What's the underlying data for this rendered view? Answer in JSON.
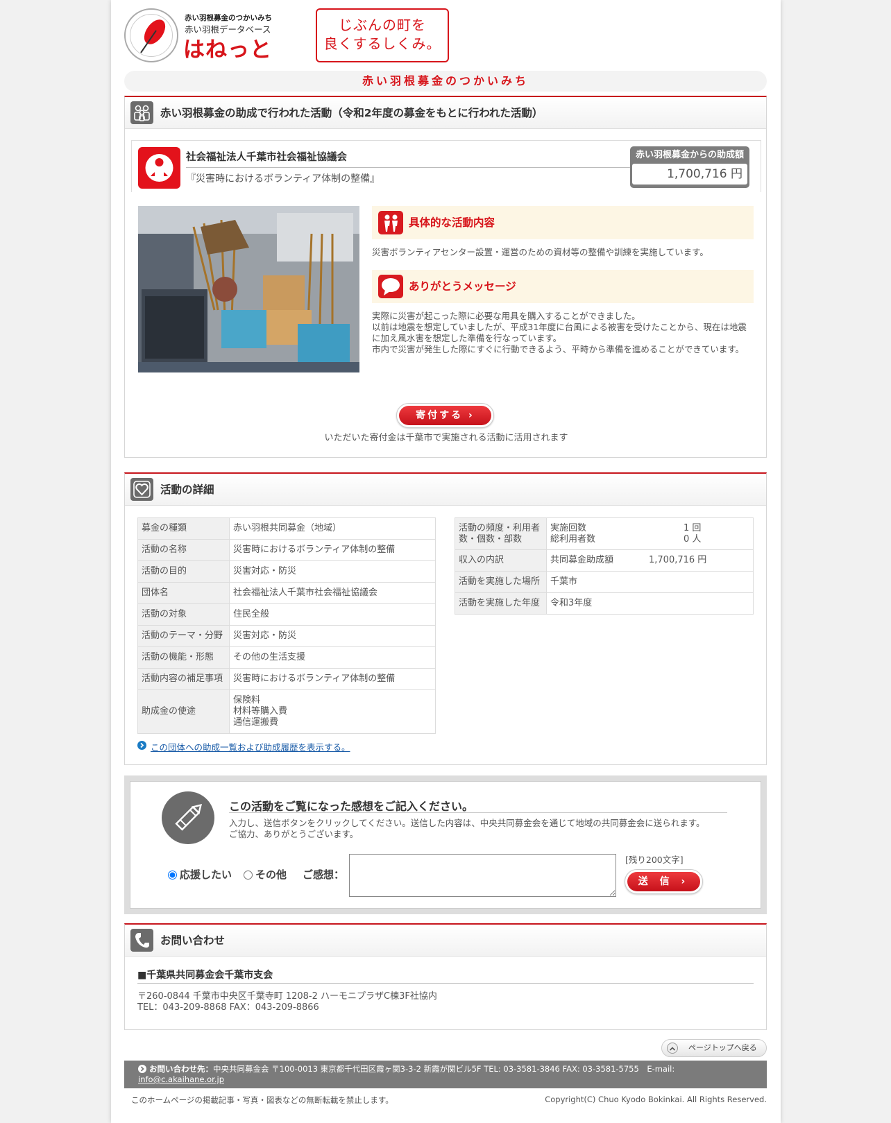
{
  "header": {
    "logo_line1": "赤い羽根募金のつかいみち",
    "logo_line2": "赤い羽根データベース",
    "logo_main": "はねっと",
    "slogan_line1": "じぶんの町を",
    "slogan_line2": "良くするしくみ。",
    "page_title": "赤い羽根募金のつかいみち"
  },
  "colors": {
    "brand_red": "#d7151b",
    "gray_icon": "#6b6b6b",
    "link_blue": "#1a5ca8"
  },
  "activity_section": {
    "title": "赤い羽根募金の助成で行われた活動（令和2年度の募金をもとに行われた活動）",
    "icon": "people-icon",
    "org_name": "社会福祉法人千葉市社会福祉協議会",
    "activity_name": "『災害時におけるボランティア体制の整備』",
    "grant_label": "赤い羽根募金からの助成額",
    "grant_value": "1,700,716 円",
    "content_title": "具体的な活動内容",
    "content_text": "災害ボランティアセンター設置・運営のための資材等の整備や訓練を実施しています。",
    "thanks_title": "ありがとうメッセージ",
    "thanks_lines": [
      "実際に災害が起こった際に必要な用具を購入することができました。",
      "以前は地震を想定していましたが、平成31年度に台風による被害を受けたことから、現在は地震に加え風水害を想定した準備を行なっています。",
      "市内で災害が発生した際にすぐに行動できるよう、平時から準備を進めることができています。"
    ],
    "donate_label": "寄付する ›",
    "donate_note": "いただいた寄付金は千葉市で実施される活動に活用されます"
  },
  "details_section": {
    "title": "活動の詳細",
    "left_rows": [
      {
        "k": "募金の種類",
        "v": "赤い羽根共同募金（地域）"
      },
      {
        "k": "活動の名称",
        "v": "災害時におけるボランティア体制の整備"
      },
      {
        "k": "活動の目的",
        "v": "災害対応・防災"
      },
      {
        "k": "団体名",
        "v": "社会福祉法人千葉市社会福祉協議会"
      },
      {
        "k": "活動の対象",
        "v": "住民全般"
      },
      {
        "k": "活動のテーマ・分野",
        "v": "災害対応・防災"
      },
      {
        "k": "活動の機能・形態",
        "v": "その他の生活支援"
      },
      {
        "k": "活動内容の補足事項",
        "v": "災害時におけるボランティア体制の整備"
      },
      {
        "k": "助成金の使途",
        "v": "保険料\n材料等購入費\n通信運搬費"
      }
    ],
    "right": {
      "freq_key": "活動の頻度・利用者数・個数・部数",
      "freq_items": [
        {
          "label": "実施回数",
          "value": "1 回"
        },
        {
          "label": "総利用者数",
          "value": "0 人"
        }
      ],
      "income_key": "収入の内訳",
      "income_label": "共同募金助成額",
      "income_value": "1,700,716 円",
      "place_key": "活動を実施した場所",
      "place_value": "千葉市",
      "year_key": "活動を実施した年度",
      "year_value": "令和3年度"
    },
    "history_link": "この団体への助成一覧および助成履歴を表示する。"
  },
  "feedback": {
    "title": "この活動をご覧になった感想をご記入ください。",
    "desc_line1": "入力し、送信ボタンをクリックしてください。送信した内容は、中央共同募金会を通じて地域の共同募金会に送られます。",
    "desc_line2": "ご協力、ありがとうございます。",
    "radio_support": "応援したい",
    "radio_other": "その他",
    "impression_label": "ご感想：",
    "remaining": "[残り200文字]",
    "send_label": "送 信 ›",
    "textarea_value": ""
  },
  "contact": {
    "title": "お問い合わせ",
    "org": "■千葉県共同募金会千葉市支会",
    "address": "〒260-0844 千葉市中央区千葉寺町 1208-2 ハーモニプラザC棟3F社協内",
    "tel_fax": "TEL：043-209-8868 FAX：043-209-8866"
  },
  "footer": {
    "page_top": "ページトップへ戻る",
    "contact_label": "お問い合わせ先：",
    "contact_text": "中央共同募金会 〒100-0013 東京都千代田区霞ヶ関3-3-2 新霞が関ビル5F TEL: 03-3581-3846 FAX: 03-3581-5755　E-mail:",
    "email": "info@c.akaihane.or.jp",
    "notice": "このホームページの掲載記事・写真・図表などの無断転載を禁止します。",
    "copyright": "Copyright(C) Chuo Kyodo Bokinkai. All Rights Reserved."
  }
}
